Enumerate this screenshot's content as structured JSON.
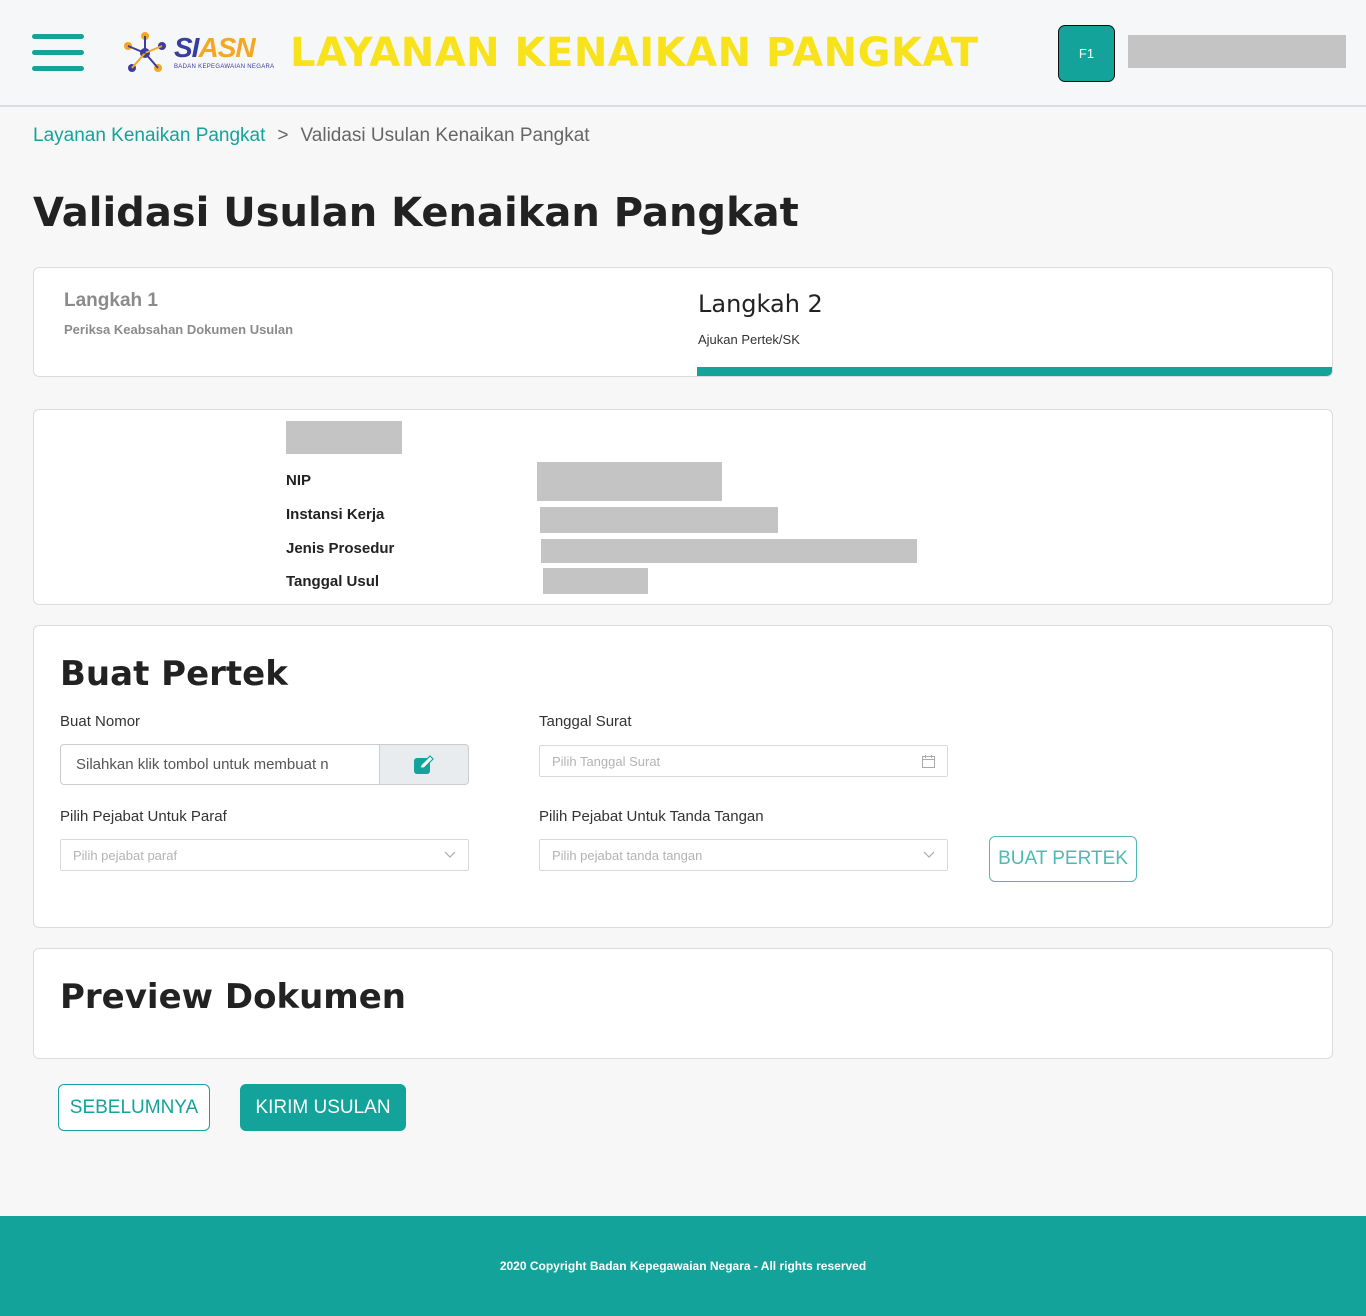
{
  "header": {
    "app_title": "LAYANAN KENAIKAN PANGKAT",
    "logo_text_main": "SI",
    "logo_text_accent": "ASN",
    "logo_subtext": "BADAN KEPEGAWAIAN NEGARA",
    "avatar_initials": "F1"
  },
  "breadcrumb": {
    "parent": "Layanan Kenaikan Pangkat",
    "separator": ">",
    "current": "Validasi Usulan Kenaikan Pangkat"
  },
  "page_title": "Validasi Usulan Kenaikan Pangkat",
  "steps": [
    {
      "title": "Langkah 1",
      "subtitle": "Periksa Keabsahan Dokumen Usulan",
      "active": false
    },
    {
      "title": "Langkah 2",
      "subtitle": "Ajukan Pertek/SK",
      "active": true
    }
  ],
  "info": {
    "labels": {
      "nip": "NIP",
      "instansi": "Instansi Kerja",
      "prosedur": "Jenis Prosedur",
      "tanggal": "Tanggal Usul"
    }
  },
  "pertek": {
    "title": "Buat Pertek",
    "nomor_label": "Buat Nomor",
    "nomor_value": "Silahkan klik tombol untuk membuat n",
    "tanggal_label": "Tanggal Surat",
    "tanggal_placeholder": "Pilih Tanggal Surat",
    "paraf_label": "Pilih Pejabat Untuk Paraf",
    "paraf_placeholder": "Pilih pejabat paraf",
    "ttd_label": "Pilih Pejabat Untuk Tanda Tangan",
    "ttd_placeholder": "Pilih pejabat tanda tangan",
    "buat_button": "BUAT PERTEK"
  },
  "preview": {
    "title": "Preview Dokumen"
  },
  "actions": {
    "prev": "SEBELUMNYA",
    "submit": "KIRIM USULAN"
  },
  "footer": {
    "copyright": "2020 Copyright Badan Kepegawaian Negara - All rights reserved"
  },
  "colors": {
    "primary": "#13a39a",
    "title_yellow": "#f7e21b",
    "redacted": "#c4c4c4"
  }
}
